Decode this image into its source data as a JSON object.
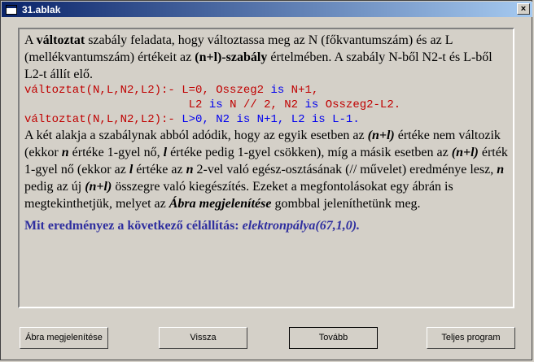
{
  "window": {
    "title": "31.ablak",
    "close_label": "×"
  },
  "text": {
    "p1_a": "A ",
    "p1_b": "változtat",
    "p1_c": " szabály feladata, hogy változtassa meg az N (főkvantumszám) és az L (mellékvantumszám) értékeit az ",
    "p1_d": "(n+l)-szabály",
    "p1_e": " értelmében. A szabály N-ből N2-t és L-ből L2-t állít elő.",
    "code1_head": "változtat(N,L,N2,L2):-",
    "code1_r1a": " L=0, Osszeg2 ",
    "code1_is1": "is",
    "code1_r1b": " N+1,",
    "code1_r2a": "L2 ",
    "code1_is2": "is",
    "code1_r2b": " N // 2, N2 ",
    "code1_is3": "is",
    "code1_r2c": " Osszeg2-L2.",
    "code2_head": "változtat(N,L,N2,L2):-",
    "code2_a": " L>0, N2 ",
    "code2_is1": "is",
    "code2_b": " N+1, L2 ",
    "code2_is2": "is",
    "code2_c": " L-1.",
    "p2_1": "A két alakja a szabálynak abból adódik, hogy az egyik esetben az ",
    "p2_2": "(n+l)",
    "p2_3": " értéke nem változik (ekkor ",
    "p2_4": "n",
    "p2_5": " értéke 1-gyel nő, ",
    "p2_6": "l",
    "p2_7": " értéke pedig 1-gyel csökken), míg a másik esetben az ",
    "p2_8": "(n+l)",
    "p2_9": " érték 1-gyel nő (ekkor az ",
    "p2_10": "l",
    "p2_11": " értéke az ",
    "p2_12": "n",
    "p2_13": " 2-vel való egész-osztásának (// művelet) eredménye lesz, ",
    "p2_14": "n",
    "p2_15": " pedig az új ",
    "p2_16": "(n+l)",
    "p2_17": " összegre való kiegészítés. Ezeket a megfontolásokat egy ábrán is megtekinthetjük, melyet az ",
    "p2_18": "Ábra megjelenítése",
    "p2_19": " gombbal jeleníthetünk meg.",
    "q1": "Mit eredményez a következő célállítás: ",
    "q2": "elektronpálya(67,1,0)."
  },
  "buttons": {
    "show_figure": "Ábra megjelenítése",
    "back": "Vissza",
    "next": "Tovább",
    "full_program": "Teljes program"
  }
}
